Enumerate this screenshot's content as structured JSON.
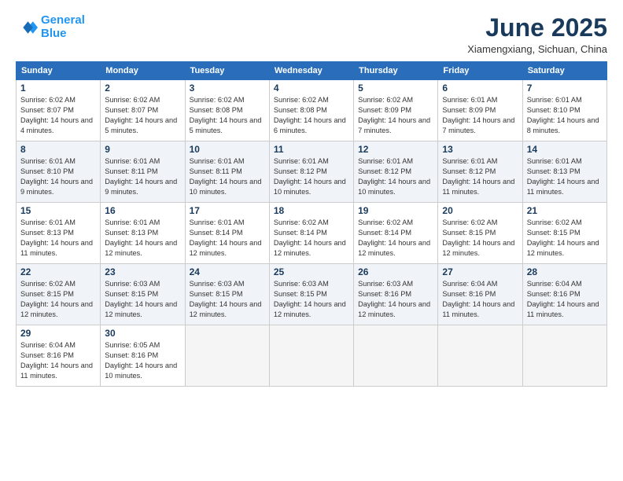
{
  "logo": {
    "line1": "General",
    "line2": "Blue"
  },
  "title": "June 2025",
  "subtitle": "Xiamengxiang, Sichuan, China",
  "headers": [
    "Sunday",
    "Monday",
    "Tuesday",
    "Wednesday",
    "Thursday",
    "Friday",
    "Saturday"
  ],
  "weeks": [
    [
      {
        "day": "1",
        "sunrise": "Sunrise: 6:02 AM",
        "sunset": "Sunset: 8:07 PM",
        "daylight": "Daylight: 14 hours and 4 minutes."
      },
      {
        "day": "2",
        "sunrise": "Sunrise: 6:02 AM",
        "sunset": "Sunset: 8:07 PM",
        "daylight": "Daylight: 14 hours and 5 minutes."
      },
      {
        "day": "3",
        "sunrise": "Sunrise: 6:02 AM",
        "sunset": "Sunset: 8:08 PM",
        "daylight": "Daylight: 14 hours and 5 minutes."
      },
      {
        "day": "4",
        "sunrise": "Sunrise: 6:02 AM",
        "sunset": "Sunset: 8:08 PM",
        "daylight": "Daylight: 14 hours and 6 minutes."
      },
      {
        "day": "5",
        "sunrise": "Sunrise: 6:02 AM",
        "sunset": "Sunset: 8:09 PM",
        "daylight": "Daylight: 14 hours and 7 minutes."
      },
      {
        "day": "6",
        "sunrise": "Sunrise: 6:01 AM",
        "sunset": "Sunset: 8:09 PM",
        "daylight": "Daylight: 14 hours and 7 minutes."
      },
      {
        "day": "7",
        "sunrise": "Sunrise: 6:01 AM",
        "sunset": "Sunset: 8:10 PM",
        "daylight": "Daylight: 14 hours and 8 minutes."
      }
    ],
    [
      {
        "day": "8",
        "sunrise": "Sunrise: 6:01 AM",
        "sunset": "Sunset: 8:10 PM",
        "daylight": "Daylight: 14 hours and 9 minutes."
      },
      {
        "day": "9",
        "sunrise": "Sunrise: 6:01 AM",
        "sunset": "Sunset: 8:11 PM",
        "daylight": "Daylight: 14 hours and 9 minutes."
      },
      {
        "day": "10",
        "sunrise": "Sunrise: 6:01 AM",
        "sunset": "Sunset: 8:11 PM",
        "daylight": "Daylight: 14 hours and 10 minutes."
      },
      {
        "day": "11",
        "sunrise": "Sunrise: 6:01 AM",
        "sunset": "Sunset: 8:12 PM",
        "daylight": "Daylight: 14 hours and 10 minutes."
      },
      {
        "day": "12",
        "sunrise": "Sunrise: 6:01 AM",
        "sunset": "Sunset: 8:12 PM",
        "daylight": "Daylight: 14 hours and 10 minutes."
      },
      {
        "day": "13",
        "sunrise": "Sunrise: 6:01 AM",
        "sunset": "Sunset: 8:12 PM",
        "daylight": "Daylight: 14 hours and 11 minutes."
      },
      {
        "day": "14",
        "sunrise": "Sunrise: 6:01 AM",
        "sunset": "Sunset: 8:13 PM",
        "daylight": "Daylight: 14 hours and 11 minutes."
      }
    ],
    [
      {
        "day": "15",
        "sunrise": "Sunrise: 6:01 AM",
        "sunset": "Sunset: 8:13 PM",
        "daylight": "Daylight: 14 hours and 11 minutes."
      },
      {
        "day": "16",
        "sunrise": "Sunrise: 6:01 AM",
        "sunset": "Sunset: 8:13 PM",
        "daylight": "Daylight: 14 hours and 12 minutes."
      },
      {
        "day": "17",
        "sunrise": "Sunrise: 6:01 AM",
        "sunset": "Sunset: 8:14 PM",
        "daylight": "Daylight: 14 hours and 12 minutes."
      },
      {
        "day": "18",
        "sunrise": "Sunrise: 6:02 AM",
        "sunset": "Sunset: 8:14 PM",
        "daylight": "Daylight: 14 hours and 12 minutes."
      },
      {
        "day": "19",
        "sunrise": "Sunrise: 6:02 AM",
        "sunset": "Sunset: 8:14 PM",
        "daylight": "Daylight: 14 hours and 12 minutes."
      },
      {
        "day": "20",
        "sunrise": "Sunrise: 6:02 AM",
        "sunset": "Sunset: 8:15 PM",
        "daylight": "Daylight: 14 hours and 12 minutes."
      },
      {
        "day": "21",
        "sunrise": "Sunrise: 6:02 AM",
        "sunset": "Sunset: 8:15 PM",
        "daylight": "Daylight: 14 hours and 12 minutes."
      }
    ],
    [
      {
        "day": "22",
        "sunrise": "Sunrise: 6:02 AM",
        "sunset": "Sunset: 8:15 PM",
        "daylight": "Daylight: 14 hours and 12 minutes."
      },
      {
        "day": "23",
        "sunrise": "Sunrise: 6:03 AM",
        "sunset": "Sunset: 8:15 PM",
        "daylight": "Daylight: 14 hours and 12 minutes."
      },
      {
        "day": "24",
        "sunrise": "Sunrise: 6:03 AM",
        "sunset": "Sunset: 8:15 PM",
        "daylight": "Daylight: 14 hours and 12 minutes."
      },
      {
        "day": "25",
        "sunrise": "Sunrise: 6:03 AM",
        "sunset": "Sunset: 8:15 PM",
        "daylight": "Daylight: 14 hours and 12 minutes."
      },
      {
        "day": "26",
        "sunrise": "Sunrise: 6:03 AM",
        "sunset": "Sunset: 8:16 PM",
        "daylight": "Daylight: 14 hours and 12 minutes."
      },
      {
        "day": "27",
        "sunrise": "Sunrise: 6:04 AM",
        "sunset": "Sunset: 8:16 PM",
        "daylight": "Daylight: 14 hours and 11 minutes."
      },
      {
        "day": "28",
        "sunrise": "Sunrise: 6:04 AM",
        "sunset": "Sunset: 8:16 PM",
        "daylight": "Daylight: 14 hours and 11 minutes."
      }
    ],
    [
      {
        "day": "29",
        "sunrise": "Sunrise: 6:04 AM",
        "sunset": "Sunset: 8:16 PM",
        "daylight": "Daylight: 14 hours and 11 minutes."
      },
      {
        "day": "30",
        "sunrise": "Sunrise: 6:05 AM",
        "sunset": "Sunset: 8:16 PM",
        "daylight": "Daylight: 14 hours and 10 minutes."
      },
      null,
      null,
      null,
      null,
      null
    ]
  ]
}
